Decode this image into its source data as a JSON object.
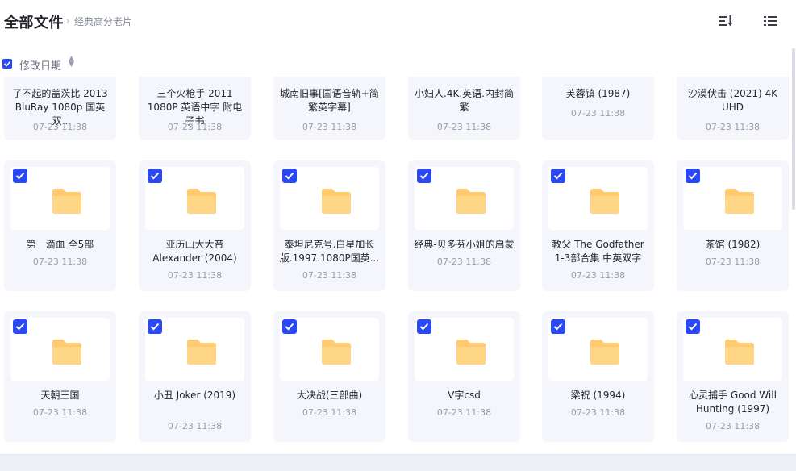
{
  "header": {
    "title": "全部文件",
    "separator": "›",
    "breadcrumb": "经典高分老片"
  },
  "sortbar": {
    "label": "修改日期",
    "arrow": "⬍"
  },
  "rows": [
    [
      {
        "name": "了不起的盖茨比 2013 BluRay 1080p 国英双..",
        "time": "07-23 11:38"
      },
      {
        "name": "三个火枪手 2011 1080P 英语中字 附电子书",
        "time": "07-23 11:38"
      },
      {
        "name": "城南旧事[国语音轨+简繁英字幕]",
        "time": "07-23 11:38"
      },
      {
        "name": "小妇人.4K.英语.内封简繁",
        "time": "07-23 11:38"
      },
      {
        "name": "芙蓉镇 (1987)",
        "time": "07-23 11:38"
      },
      {
        "name": "沙漠伏击 (2021) 4K UHD",
        "time": "07-23 11:38"
      }
    ],
    [
      {
        "name": "第一滴血 全5部",
        "time": "07-23 11:38"
      },
      {
        "name": "亚历山大大帝 Alexander (2004)",
        "time": "07-23 11:38"
      },
      {
        "name": "泰坦尼克号.白星加长版.1997.1080P国英...",
        "time": "07-23 11:38"
      },
      {
        "name": "经典-贝多芬小姐的启蒙",
        "time": "07-23 11:38"
      },
      {
        "name": "教父 The Godfather 1-3部合集 中英双字",
        "time": "07-23 11:38"
      },
      {
        "name": "茶馆 (1982)",
        "time": "07-23 11:38"
      }
    ],
    [
      {
        "name": "天朝王国",
        "time": "07-23 11:38"
      },
      {
        "name": "小丑 Joker (2019)",
        "time": "07-23 11:38"
      },
      {
        "name": "大决战(三部曲)",
        "time": "07-23 11:38"
      },
      {
        "name": "V字csd",
        "time": "07-23 11:38"
      },
      {
        "name": "梁祝 (1994)",
        "time": "07-23 11:38"
      },
      {
        "name": "心灵捕手 Good Will Hunting (1997)",
        "time": "07-23 11:38"
      }
    ]
  ],
  "colors": {
    "accent": "#2b48f5",
    "folder": "#ffca70",
    "card_bg": "#f5f6fb"
  },
  "icons": {
    "sort": "sort-icon",
    "list": "list-view-icon",
    "folder": "folder-icon",
    "check": "checkbox-checked-icon"
  }
}
